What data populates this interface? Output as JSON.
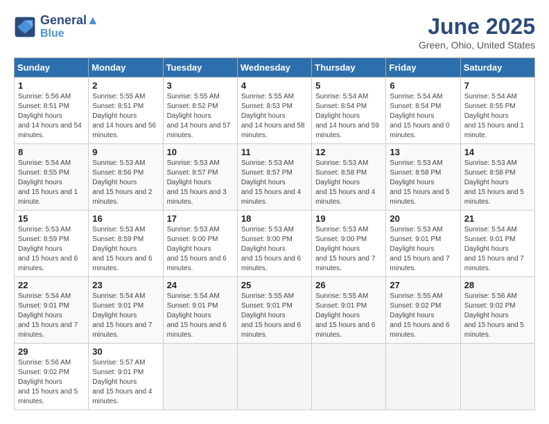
{
  "logo": {
    "line1": "General",
    "line2": "Blue"
  },
  "title": "June 2025",
  "subtitle": "Green, Ohio, United States",
  "headers": [
    "Sunday",
    "Monday",
    "Tuesday",
    "Wednesday",
    "Thursday",
    "Friday",
    "Saturday"
  ],
  "weeks": [
    [
      {
        "day": "1",
        "sunrise": "5:56 AM",
        "sunset": "8:51 PM",
        "daylight": "14 hours and 54 minutes."
      },
      {
        "day": "2",
        "sunrise": "5:55 AM",
        "sunset": "8:51 PM",
        "daylight": "14 hours and 56 minutes."
      },
      {
        "day": "3",
        "sunrise": "5:55 AM",
        "sunset": "8:52 PM",
        "daylight": "14 hours and 57 minutes."
      },
      {
        "day": "4",
        "sunrise": "5:55 AM",
        "sunset": "8:53 PM",
        "daylight": "14 hours and 58 minutes."
      },
      {
        "day": "5",
        "sunrise": "5:54 AM",
        "sunset": "8:54 PM",
        "daylight": "14 hours and 59 minutes."
      },
      {
        "day": "6",
        "sunrise": "5:54 AM",
        "sunset": "8:54 PM",
        "daylight": "15 hours and 0 minutes."
      },
      {
        "day": "7",
        "sunrise": "5:54 AM",
        "sunset": "8:55 PM",
        "daylight": "15 hours and 1 minute."
      }
    ],
    [
      {
        "day": "8",
        "sunrise": "5:54 AM",
        "sunset": "8:55 PM",
        "daylight": "15 hours and 1 minute."
      },
      {
        "day": "9",
        "sunrise": "5:53 AM",
        "sunset": "8:56 PM",
        "daylight": "15 hours and 2 minutes."
      },
      {
        "day": "10",
        "sunrise": "5:53 AM",
        "sunset": "8:57 PM",
        "daylight": "15 hours and 3 minutes."
      },
      {
        "day": "11",
        "sunrise": "5:53 AM",
        "sunset": "8:57 PM",
        "daylight": "15 hours and 4 minutes."
      },
      {
        "day": "12",
        "sunrise": "5:53 AM",
        "sunset": "8:58 PM",
        "daylight": "15 hours and 4 minutes."
      },
      {
        "day": "13",
        "sunrise": "5:53 AM",
        "sunset": "8:58 PM",
        "daylight": "15 hours and 5 minutes."
      },
      {
        "day": "14",
        "sunrise": "5:53 AM",
        "sunset": "8:58 PM",
        "daylight": "15 hours and 5 minutes."
      }
    ],
    [
      {
        "day": "15",
        "sunrise": "5:53 AM",
        "sunset": "8:59 PM",
        "daylight": "15 hours and 6 minutes."
      },
      {
        "day": "16",
        "sunrise": "5:53 AM",
        "sunset": "8:59 PM",
        "daylight": "15 hours and 6 minutes."
      },
      {
        "day": "17",
        "sunrise": "5:53 AM",
        "sunset": "9:00 PM",
        "daylight": "15 hours and 6 minutes."
      },
      {
        "day": "18",
        "sunrise": "5:53 AM",
        "sunset": "9:00 PM",
        "daylight": "15 hours and 6 minutes."
      },
      {
        "day": "19",
        "sunrise": "5:53 AM",
        "sunset": "9:00 PM",
        "daylight": "15 hours and 7 minutes."
      },
      {
        "day": "20",
        "sunrise": "5:53 AM",
        "sunset": "9:01 PM",
        "daylight": "15 hours and 7 minutes."
      },
      {
        "day": "21",
        "sunrise": "5:54 AM",
        "sunset": "9:01 PM",
        "daylight": "15 hours and 7 minutes."
      }
    ],
    [
      {
        "day": "22",
        "sunrise": "5:54 AM",
        "sunset": "9:01 PM",
        "daylight": "15 hours and 7 minutes."
      },
      {
        "day": "23",
        "sunrise": "5:54 AM",
        "sunset": "9:01 PM",
        "daylight": "15 hours and 7 minutes."
      },
      {
        "day": "24",
        "sunrise": "5:54 AM",
        "sunset": "9:01 PM",
        "daylight": "15 hours and 6 minutes."
      },
      {
        "day": "25",
        "sunrise": "5:55 AM",
        "sunset": "9:01 PM",
        "daylight": "15 hours and 6 minutes."
      },
      {
        "day": "26",
        "sunrise": "5:55 AM",
        "sunset": "9:01 PM",
        "daylight": "15 hours and 6 minutes."
      },
      {
        "day": "27",
        "sunrise": "5:55 AM",
        "sunset": "9:02 PM",
        "daylight": "15 hours and 6 minutes."
      },
      {
        "day": "28",
        "sunrise": "5:56 AM",
        "sunset": "9:02 PM",
        "daylight": "15 hours and 5 minutes."
      }
    ],
    [
      {
        "day": "29",
        "sunrise": "5:56 AM",
        "sunset": "9:02 PM",
        "daylight": "15 hours and 5 minutes."
      },
      {
        "day": "30",
        "sunrise": "5:57 AM",
        "sunset": "9:01 PM",
        "daylight": "15 hours and 4 minutes."
      },
      null,
      null,
      null,
      null,
      null
    ]
  ]
}
